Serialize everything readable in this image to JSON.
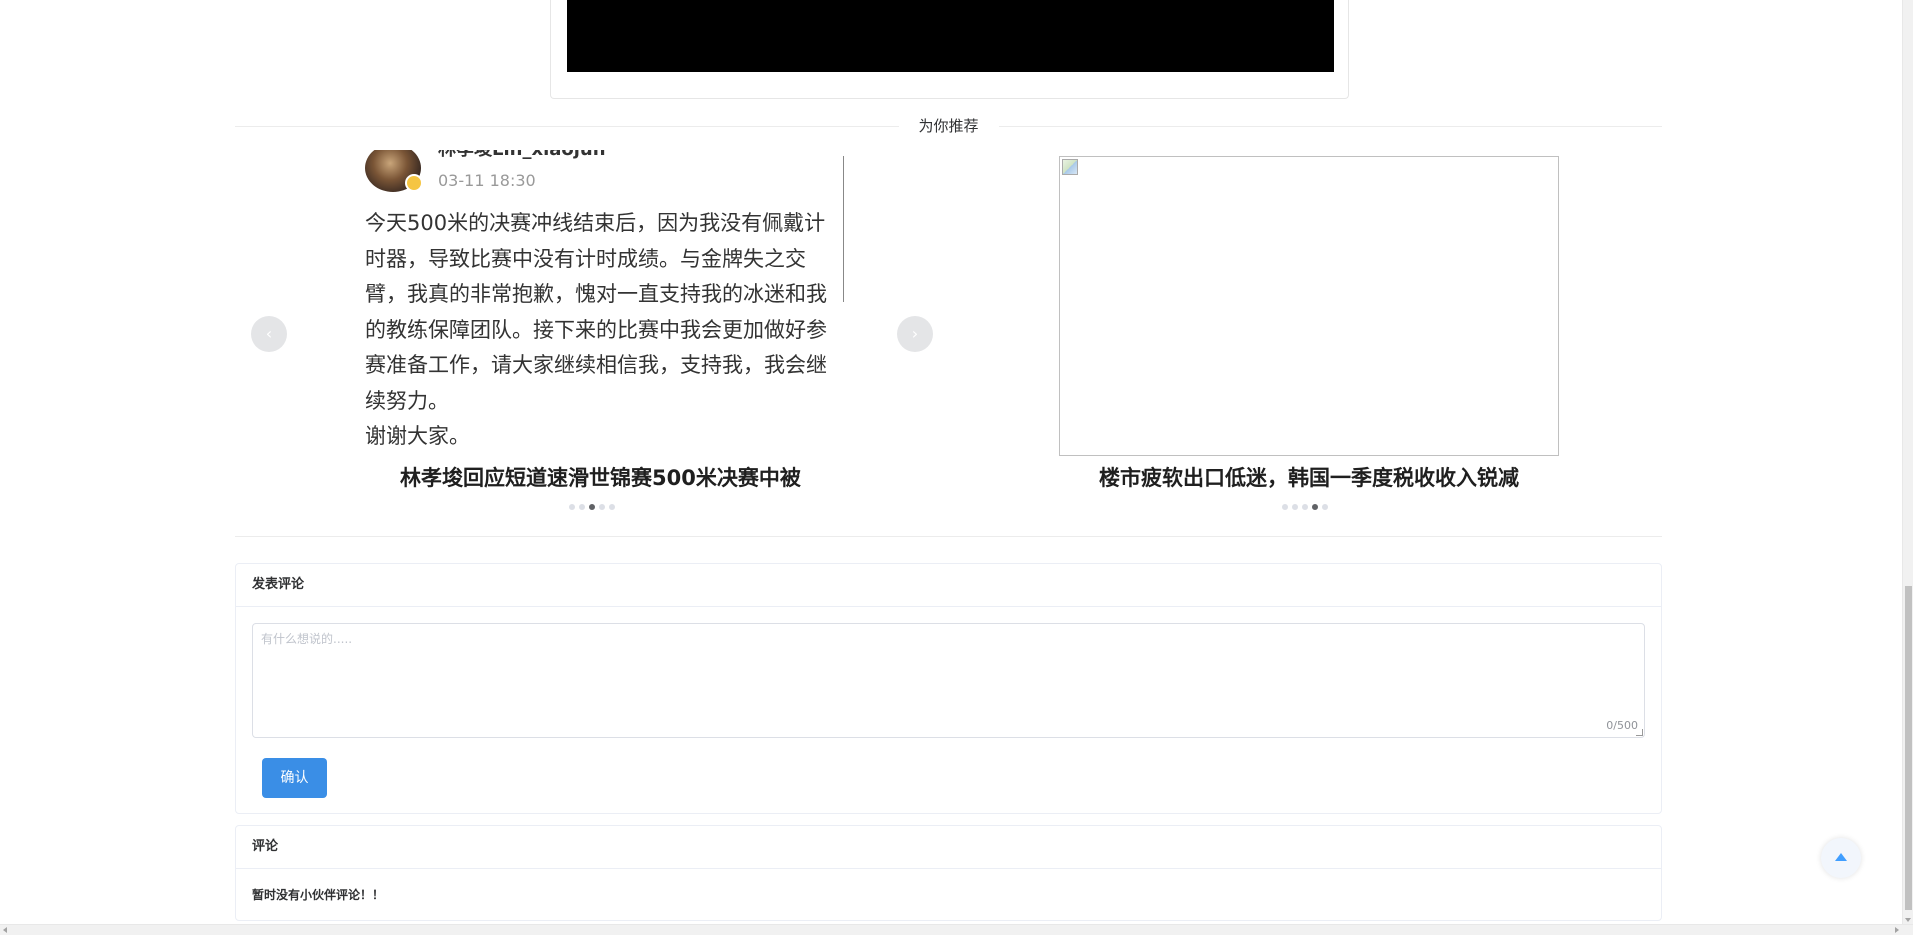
{
  "recommend": {
    "title": "为你推荐"
  },
  "carousel_left": {
    "weibo": {
      "username": "林孝埈Lin_xiaojun",
      "time": "03-11 18:30",
      "text": "今天500米的决赛冲线结束后，因为我没有佩戴计时器，导致比赛中没有计时成绩。与金牌失之交臂，我真的非常抱歉，愧对一直支持我的冰迷和我的教练保障团队。接下来的比赛中我会更加做好参赛准备工作，请大家继续相信我，支持我，我会继续努力。",
      "text2": "谢谢大家。"
    },
    "caption": "林孝埈回应短道速滑世锦赛500米决赛中被",
    "prev_icon": "chevron-left-icon",
    "next_icon": "chevron-right-icon",
    "active_index": 2,
    "dot_count": 5
  },
  "carousel_right": {
    "caption": "楼市疲软出口低迷，韩国一季度税收收入锐减",
    "active_index": 3,
    "dot_count": 5
  },
  "comment_form": {
    "header": "发表评论",
    "placeholder": "有什么想说的.....",
    "count": "0/500",
    "submit_label": "确认"
  },
  "comments": {
    "header": "评论",
    "empty_text": "暂时没有小伙伴评论！！"
  },
  "colors": {
    "primary": "#3a8ee6",
    "backtop_icon": "#409eff",
    "active_dot": "#606266"
  }
}
